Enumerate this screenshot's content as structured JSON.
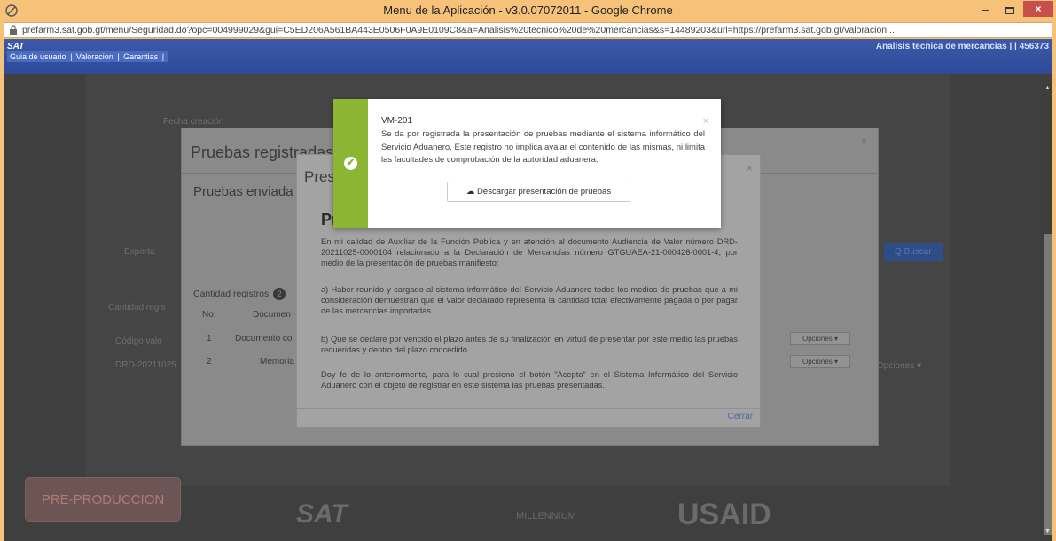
{
  "window": {
    "title": "Menu de la Aplicación - v3.0.07072011 - Google Chrome",
    "minimize": "–",
    "close": "×"
  },
  "address": {
    "url": "prefarm3.sat.gob.gt/menu/Seguridad.do?opc=004999029&gui=C5ED206A561BA443E0506F0A9E0109C8&a=Analisis%20tecnico%20de%20mercancias&s=14489203&url=https://prefarm3.sat.gob.gt/valoracion..."
  },
  "header": {
    "logo": "SAT",
    "module": "Analisis tecnica de mercancias | | 456373",
    "nav": [
      "Guia de usuario",
      "|",
      "Valoracion",
      "|",
      "Garantias",
      "|"
    ]
  },
  "background_page": {
    "fecha_label": "Fecha creación",
    "exportar": "Exporta",
    "buscar": "Q Buscar",
    "cantidad": "Cantidad regis",
    "codigo": "Código valo",
    "drd": "DRD-20211025",
    "opciones": "Opciones ▾",
    "pre_produccion": "PRE-PRODUCCION",
    "logos": [
      "SAT",
      "MILLENNIUM",
      "USAID"
    ]
  },
  "modal_pruebas": {
    "title": "Pruebas registradas",
    "close": "×",
    "subtitle": "Pruebas enviada",
    "count_label": "Cantidad registros",
    "count_value": "2",
    "col_no": "No.",
    "col_doc": "Documen",
    "rows": [
      {
        "no": "1",
        "doc": "Documento co",
        "action": "Opciones ▾"
      },
      {
        "no": "2",
        "doc": "Memoria",
        "action": "Opciones ▾"
      }
    ]
  },
  "modal_presentacion": {
    "title": "Pres",
    "close": "×",
    "heading": "Pr",
    "p1": "En mi calidad de Auxiliar de la Función Pública y en atención al documento Audiencia de Valor número DRD-20211025-0000104 relacionado a la Declaración de Mercancías número GTGUAEA-21-000426-0001-4, por medio de la presentación de pruebas manifiesto:",
    "p2": "a) Haber reunido y cargado al sistema informático del Servicio Aduanero todos los medios de pruebas que a mi consideración demuestran que el valor declarado representa la cantidad total efectivamente pagada o por pagar de las mercancías importadas.",
    "p3": "b) Que se declare por vencido el plazo antes de su finalización en virtud de presentar por este medio las pruebas requeridas y dentro del plazo concedido.",
    "p4": "Doy fe de lo anteriormente, para lo cual presiono el botón \"Acepto\" en el Sistema Informático del Servicio Aduanero con el objeto de registrar en este sistema las pruebas presentadas.",
    "cerrar": "Cerrar"
  },
  "toast": {
    "code": "VM-201",
    "close": "×",
    "message": "Se da por registrada la presentación de pruebas mediante el sistema informático del Servicio Aduanero. Este registro no implica avalar el contenido de las mismas, ni limita las facultades de comprobación de la autoridad aduanera.",
    "download_label": "Descargar presentación de pruebas",
    "accent": "#8bb532"
  }
}
